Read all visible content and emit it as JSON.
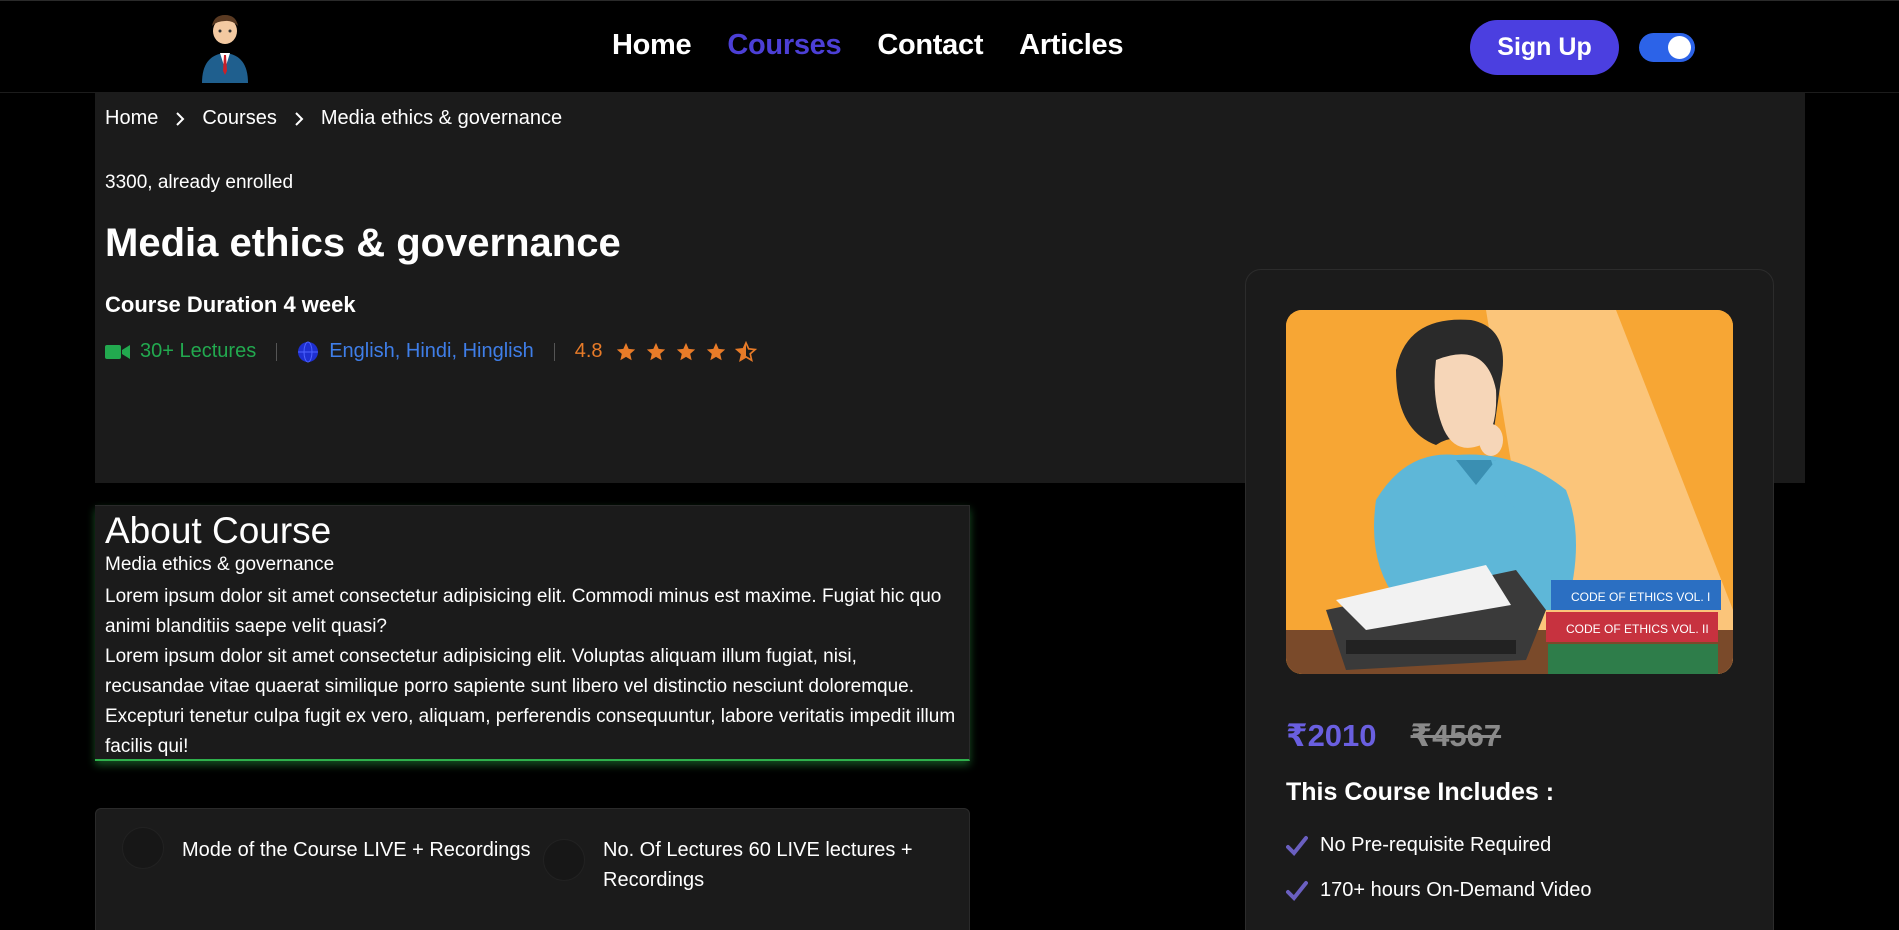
{
  "nav": {
    "links": [
      "Home",
      "Courses",
      "Contact",
      "Articles"
    ],
    "active": "Courses",
    "signup_label": "Sign Up"
  },
  "breadcrumb": [
    "Home",
    "Courses",
    "Media ethics & governance"
  ],
  "hero": {
    "enrolled": "3300, already enrolled",
    "title": "Media ethics & governance",
    "duration": "Course Duration 4 week",
    "lectures": "30+ Lectures",
    "languages": "English, Hindi, Hinglish",
    "rating": "4.8",
    "rating_stars": 4.5
  },
  "about": {
    "heading": "About Course",
    "subtitle": "Media ethics & governance",
    "para1": "Lorem ipsum dolor sit amet consectetur adipisicing elit. Commodi minus est maxime. Fugiat hic quo animi blanditiis saepe velit quasi?",
    "para2": "Lorem ipsum dolor sit amet consectetur adipisicing elit. Voluptas aliquam illum fugiat, nisi, recusandae vitae quaerat similique porro sapiente sunt libero vel distinctio nesciunt doloremque. Excepturi tenetur culpa fugit ex vero, aliquam, perferendis consequuntur, labore veritatis impedit illum facilis qui!"
  },
  "info": {
    "mode": "Mode of the Course LIVE + Recordings",
    "lectures": "No. Of Lectures 60 LIVE lectures + Recordings"
  },
  "card": {
    "price": "₹2010",
    "old_price": "₹4567",
    "includes_title": "This Course Includes :",
    "includes": [
      "No Pre-requisite Required",
      "170+ hours On-Demand Video"
    ],
    "book_labels": [
      "CODE OF ETHICS VOL. I",
      "CODE OF ETHICS VOL. II"
    ]
  },
  "colors": {
    "accent": "#4b3fe0",
    "active_link": "#4c3fd6",
    "lectures": "#22a94f",
    "languages": "#3f7ee8",
    "rating": "#e87b28",
    "price": "#6a5fe0"
  },
  "icons": [
    "logo-avatar",
    "chevron-right-icon",
    "video-icon",
    "globe-icon",
    "star-icon",
    "check-icon"
  ]
}
